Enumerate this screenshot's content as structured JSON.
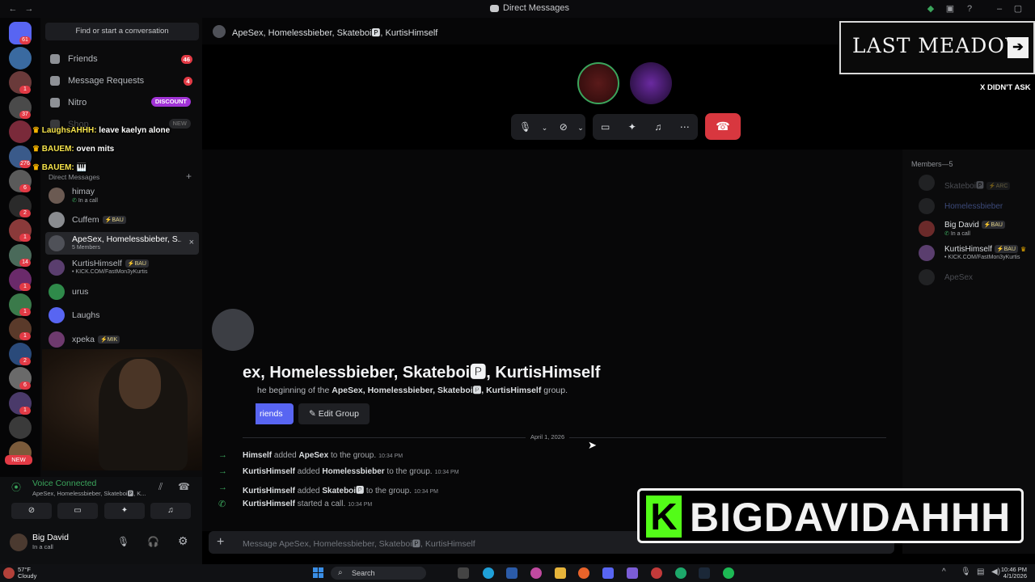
{
  "window": {
    "title": "Direct Messages"
  },
  "sidebar": {
    "find_placeholder": "Find or start a conversation",
    "nav": [
      {
        "label": "Friends",
        "badge": "46",
        "icon": "friends-icon"
      },
      {
        "label": "Message Requests",
        "badge": "4",
        "icon": "envelope-icon"
      },
      {
        "label": "Nitro",
        "badge": "DISCOUNT",
        "icon": "nitro-icon"
      },
      {
        "label": "Shop",
        "badge": "NEW",
        "icon": "shop-icon"
      }
    ],
    "section_label": "Direct Messages",
    "dms": [
      {
        "name": "himay",
        "sub": "In a call",
        "tag": ""
      },
      {
        "name": "Cuffem",
        "sub": "",
        "tag": "BAU"
      },
      {
        "name": "ApeSex, Homelessbieber, S...",
        "sub": "5 Members",
        "tag": ""
      },
      {
        "name": "KurtisHimself",
        "sub": "• KICK.COM/FastMon3yKurtis",
        "tag": "BAU"
      },
      {
        "name": "urus",
        "sub": "",
        "tag": ""
      },
      {
        "name": "Laughs",
        "sub": "",
        "tag": ""
      },
      {
        "name": "xpeka",
        "sub": "",
        "tag": "MIK"
      }
    ]
  },
  "overlay_chat": [
    {
      "user": "LaughsAHHH:",
      "msg": " leave kaelyn alone"
    },
    {
      "user": "BAUEM:",
      "msg": " oven mits"
    },
    {
      "user": "BAUEM:",
      "msg": " 🎹"
    }
  ],
  "server_badges": [
    "61",
    "1",
    "37",
    "276",
    "6",
    "2",
    "1",
    "14",
    "1",
    "1",
    "1",
    "2",
    "6",
    "1",
    "NEW"
  ],
  "voice": {
    "status": "Voice Connected",
    "channel": "ApeSex, Homelessbieber, Skateboi🅿, K..."
  },
  "user": {
    "name": "Big David",
    "status": "In a call"
  },
  "header": {
    "title": "ApeSex, Homelessbieber, Skateboi🅿, KurtisHimself"
  },
  "members": {
    "title": "Members—5",
    "list": [
      {
        "name": "Skateboi🅿",
        "tag": "ARC",
        "sub": "",
        "dim": true
      },
      {
        "name": "Homelessbieber",
        "tag": "",
        "sub": "",
        "dim": true
      },
      {
        "name": "Big David",
        "tag": "BAU",
        "sub": "In a call",
        "dim": false
      },
      {
        "name": "KurtisHimself",
        "tag": "BAU",
        "sub": "• KICK.COM/FastMon3yKurtis",
        "dim": false
      },
      {
        "name": "ApeSex",
        "tag": "",
        "sub": "",
        "dim": true
      }
    ]
  },
  "group": {
    "title": "ex, Homelessbieber, Skateboi🅿, KurtisHimself",
    "desc_prefix": "he beginning of the ",
    "desc_names": "ApeSex, Homelessbieber, Skateboi🅿, KurtisHimself",
    "desc_suffix": " group.",
    "add_friends": "riends",
    "edit_group": "Edit Group"
  },
  "date_divider": "April 1, 2026",
  "system_messages": [
    {
      "actor": "Himself",
      "verb": " added ",
      "target": "ApeSex",
      "tail": " to the group.",
      "time": "10:34 PM",
      "icon": "arrow-right-icon"
    },
    {
      "actor": "KurtisHimself",
      "verb": " added ",
      "target": "Homelessbieber",
      "tail": " to the group.",
      "time": "10:34 PM",
      "icon": "arrow-right-icon"
    },
    {
      "actor": "KurtisHimself",
      "verb": " added ",
      "target": "Skateboi🅿",
      "tail": " to the group.",
      "time": "10:34 PM",
      "icon": "arrow-right-icon"
    },
    {
      "actor": "KurtisHimself",
      "verb": " started a call.",
      "target": "",
      "tail": "",
      "time": "10:34 PM",
      "icon": "phone-icon"
    }
  ],
  "composer": {
    "placeholder": "Message ApeSex, Homelessbieber, Skateboi🅿, KurtisHimself"
  },
  "banners": {
    "last_meadow": "LAST MEADOW",
    "didnt_ask": "X DIDN'T ASK",
    "kick_letter": "K",
    "kick_name": "BIGDAVIDAHHH"
  },
  "taskbar": {
    "temp": "57°F",
    "weather": "Cloudy",
    "search": "Search",
    "time": "10:46 PM",
    "date": "4/1/2026"
  },
  "colors": {
    "accent": "#5865f2",
    "danger": "#d8373f",
    "online": "#3ba55c",
    "kick_green": "#53fc18"
  }
}
